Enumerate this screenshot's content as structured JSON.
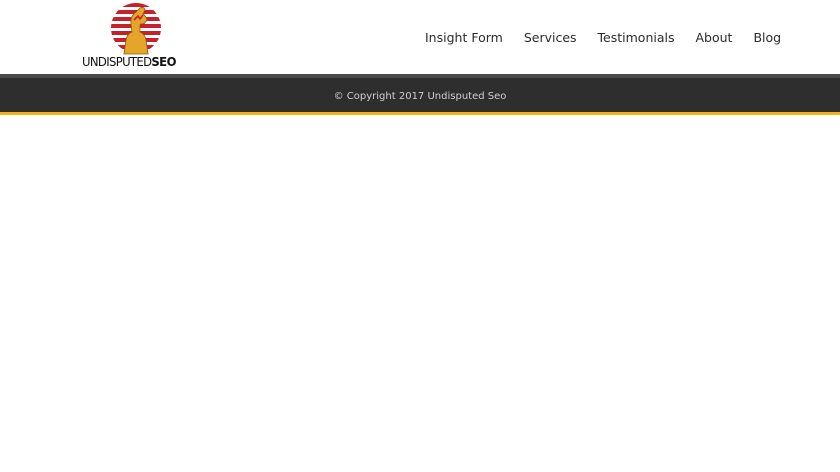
{
  "brand": {
    "name_regular": "UNDISPUTED",
    "name_bold": "SEO",
    "logo_icon": "muscle-flex-icon",
    "colors": {
      "logo_red": "#c8202a",
      "logo_gold": "#e5a52a"
    }
  },
  "nav": {
    "items": [
      {
        "label": "Insight Form"
      },
      {
        "label": "Services"
      },
      {
        "label": "Testimonials"
      },
      {
        "label": "About"
      },
      {
        "label": "Blog"
      }
    ]
  },
  "footer": {
    "copyright": "© Copyright 2017 Undisputed Seo",
    "colors": {
      "background": "#2e2e2e",
      "accent": "#f0b41a"
    }
  }
}
